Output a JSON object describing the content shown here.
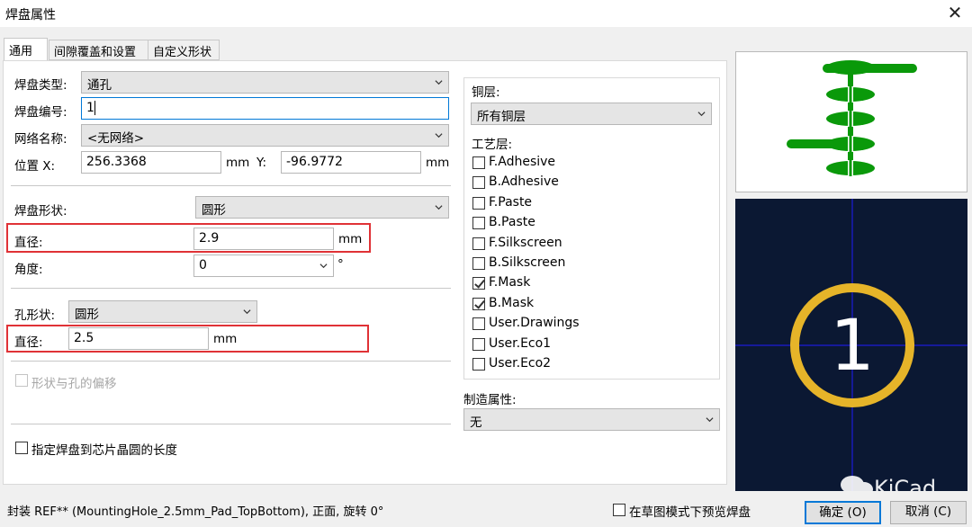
{
  "window": {
    "title": "焊盘属性",
    "close_glyph": "✕"
  },
  "tabs": [
    {
      "label": "通用",
      "active": true
    },
    {
      "label": "间隙覆盖和设置",
      "active": false
    },
    {
      "label": "自定义形状",
      "active": false
    }
  ],
  "general": {
    "pad_type_label": "焊盘类型:",
    "pad_type_value": "通孔",
    "pad_number_label": "焊盘编号:",
    "pad_number_value": "1",
    "net_label": "网络名称:",
    "net_value": "<无网络>",
    "position_x_label": "位置 X:",
    "position_x_value": "256.3368",
    "position_x_unit": "mm",
    "position_y_label": "Y:",
    "position_y_value": "-96.9772",
    "position_y_unit": "mm",
    "pad_shape_label": "焊盘形状:",
    "pad_shape_value": "圆形",
    "diameter_label": "直径:",
    "diameter_value": "2.9",
    "diameter_unit": "mm",
    "angle_label": "角度:",
    "angle_value": "0",
    "angle_unit": "°",
    "hole_shape_label": "孔形状:",
    "hole_shape_value": "圆形",
    "hole_diameter_label": "直径:",
    "hole_diameter_value": "2.5",
    "hole_diameter_unit": "mm",
    "offset_label": "形状与孔的偏移",
    "offset_checked": false,
    "die_length_label": "指定焊盘到芯片晶圆的长度",
    "die_length_checked": false
  },
  "layers": {
    "copper_label": "铜层:",
    "copper_value": "所有铜层",
    "tech_label": "工艺层:",
    "items": [
      {
        "label": "F.Adhesive",
        "checked": false
      },
      {
        "label": "B.Adhesive",
        "checked": false
      },
      {
        "label": "F.Paste",
        "checked": false
      },
      {
        "label": "B.Paste",
        "checked": false
      },
      {
        "label": "F.Silkscreen",
        "checked": false
      },
      {
        "label": "B.Silkscreen",
        "checked": false
      },
      {
        "label": "F.Mask",
        "checked": true
      },
      {
        "label": "B.Mask",
        "checked": true
      },
      {
        "label": "User.Drawings",
        "checked": false
      },
      {
        "label": "User.Eco1",
        "checked": false
      },
      {
        "label": "User.Eco2",
        "checked": false
      }
    ],
    "fab_label": "制造属性:",
    "fab_value": "无"
  },
  "preview": {
    "pad_number": "1",
    "bg_color": "#0b1833",
    "ring_color": "#e6b429",
    "crosshair_color": "#1c1cd8",
    "stack_color": "#0a990a",
    "watermark": "KiCad"
  },
  "footer": {
    "status": "封装 REF** (MountingHole_2.5mm_Pad_TopBottom), 正面, 旋转 0°",
    "sketch_label": "在草图模式下预览焊盘",
    "sketch_checked": false,
    "ok_label": "确定 (O)",
    "cancel_label": "取消 (C)"
  }
}
